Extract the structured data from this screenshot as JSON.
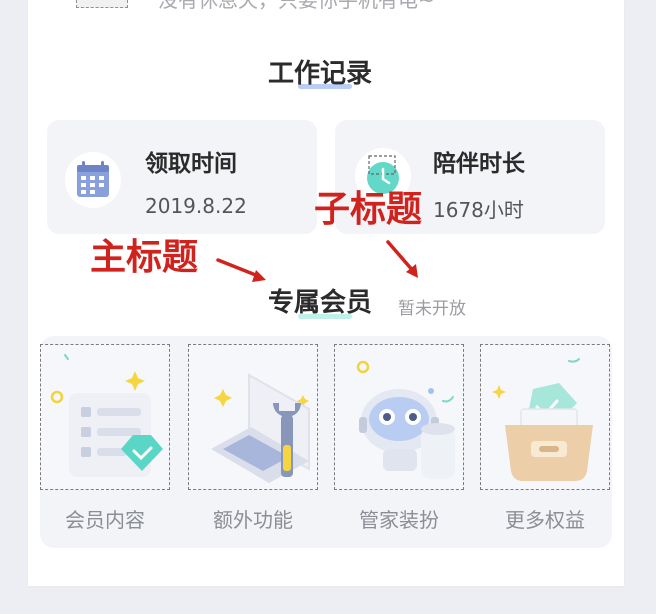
{
  "top": {
    "partial_text": "没有休息天，只要你手机有电~"
  },
  "work_record": {
    "title": "工作记录",
    "cards": [
      {
        "label": "领取时间",
        "value": "2019.8.22",
        "icon": "calendar-icon"
      },
      {
        "label": "陪伴时长",
        "value": "1678小时",
        "icon": "clock-icon"
      }
    ]
  },
  "annotations": {
    "main_title": "主标题",
    "sub_title": "子标题"
  },
  "membership": {
    "title": "专属会员",
    "tag": "暂未开放",
    "items": [
      {
        "label": "会员内容",
        "icon": "member-content-icon"
      },
      {
        "label": "额外功能",
        "icon": "laptop-wrench-icon"
      },
      {
        "label": "管家装扮",
        "icon": "robot-icon"
      },
      {
        "label": "更多权益",
        "icon": "gift-box-icon"
      }
    ]
  },
  "colors": {
    "annotation_red": "#d0231d",
    "underline_blue": "#b9cdf6",
    "underline_teal": "#bff0ea",
    "accent_teal": "#5ad6c6",
    "calendar_blue": "#7b8fd0"
  }
}
